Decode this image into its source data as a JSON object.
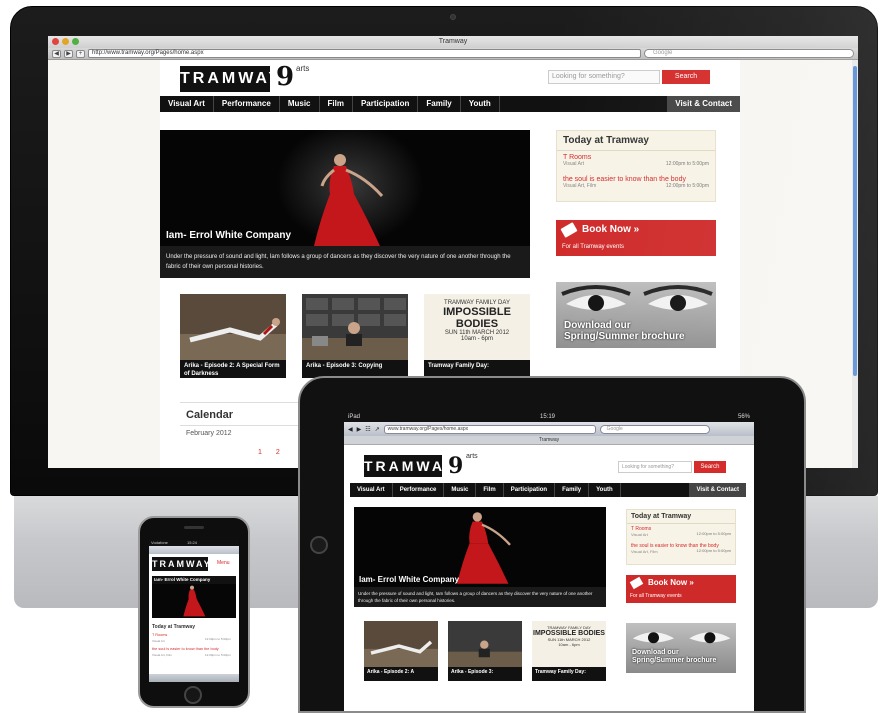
{
  "site": {
    "logo": "TRAMWAY",
    "logo_mark": "9",
    "logo_suffix": "arts",
    "search_placeholder": "Looking for something?",
    "search_button": "Search",
    "nav": [
      "Visual Art",
      "Performance",
      "Music",
      "Film",
      "Participation",
      "Family",
      "Youth"
    ],
    "nav_right": "Visit & Contact",
    "hero": {
      "title": "Iam- Errol White Company",
      "caption": "Under the pressure of sound and light, Iam follows a group of dancers as they discover the very nature of one another through the fabric of their own personal histories."
    },
    "today": {
      "heading": "Today at Tramway",
      "events": [
        {
          "name": "T Rooms",
          "category": "Visual Art",
          "time": "12:00pm to 5:00pm"
        },
        {
          "name": "the soul is easier to know than the body",
          "category": "Visual Art, Film",
          "time": "12:00pm to 5:00pm"
        }
      ]
    },
    "book": {
      "title": "Book Now »",
      "subtitle": "For all Tramway events"
    },
    "brochure": {
      "line1": "Download our",
      "line2": "Spring/Summer brochure"
    },
    "thumbs": [
      {
        "caption": "Arika - Episode 2: A Special Form of Darkness"
      },
      {
        "caption": "Arika - Episode 3: Copying"
      },
      {
        "caption": "Tramway Family Day:",
        "poster_lines": [
          "TRAMWAY FAMILY DAY",
          "IMPOSSIBLE BODIES",
          "SUN 11th MARCH 2012",
          "10am - 6pm"
        ]
      }
    ],
    "calendar": {
      "heading": "Calendar",
      "month": "February 2012",
      "days": [
        "1",
        "2"
      ]
    }
  },
  "imac": {
    "window_title": "Tramway",
    "url": "http://www.tramway.org/Pages/home.aspx",
    "search_placeholder": "Google"
  },
  "ipad": {
    "status_left": "iPad",
    "clock": "15:19",
    "battery": "56%",
    "url": "www.tramway.org/Pages/home.aspx",
    "search_placeholder": "Google",
    "tab_title": "Tramway",
    "thumb_captions": [
      "Arika - Episode 2: A",
      "Arika - Episode 3:",
      "Tramway Family Day:"
    ]
  },
  "iphone": {
    "status_left": "Vodafone",
    "clock": "15:24",
    "menu": "Menu",
    "hero_title": "Iam- Errol White Company",
    "today_heading": "Today at Tramway",
    "event1": "T Rooms",
    "event2": "the soul is easier to know than the body"
  },
  "colors": {
    "accent_red": "#d42b2b",
    "nav_black": "#111111",
    "today_bg": "#f7f3e6"
  }
}
